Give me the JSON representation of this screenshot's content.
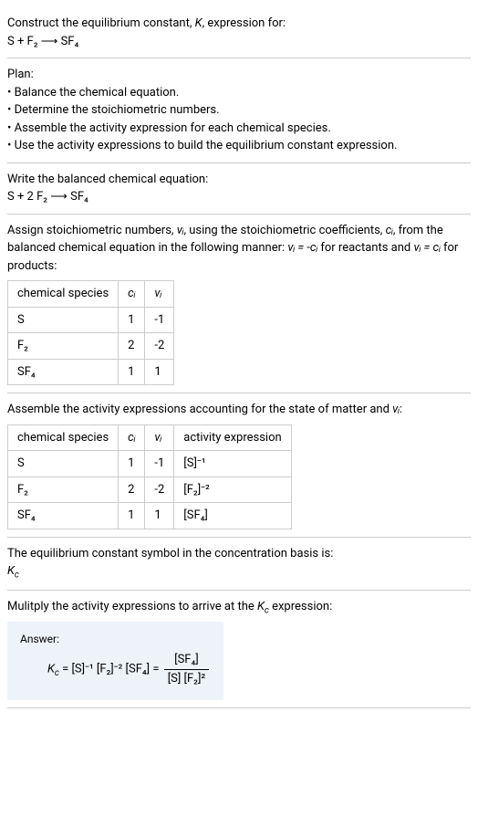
{
  "intro": {
    "line1_a": "Construct the equilibrium constant, ",
    "line1_K": "K",
    "line1_b": ", expression for:",
    "eq": "S + F₂ ⟶ SF₄"
  },
  "plan": {
    "heading": "Plan:",
    "b1": "• Balance the chemical equation.",
    "b2": "• Determine the stoichiometric numbers.",
    "b3": "• Assemble the activity expression for each chemical species.",
    "b4": "• Use the activity expressions to build the equilibrium constant expression."
  },
  "balanced": {
    "line": "Write the balanced chemical equation:",
    "eq": "S + 2 F₂ ⟶ SF₄"
  },
  "stoich": {
    "text_a": "Assign stoichiometric numbers, ",
    "nu_i": "νᵢ",
    "text_b": ", using the stoichiometric coefficients, ",
    "c_i": "cᵢ",
    "text_c": ", from the balanced chemical equation in the following manner: ",
    "rel1": "νᵢ = -cᵢ",
    "text_d": " for reactants and ",
    "rel2": "νᵢ = cᵢ",
    "text_e": " for products:",
    "table": {
      "h1": "chemical species",
      "h2": "cᵢ",
      "h3": "νᵢ",
      "r1": {
        "sp": "S",
        "c": "1",
        "n": "-1"
      },
      "r2": {
        "sp": "F₂",
        "c": "2",
        "n": "-2"
      },
      "r3": {
        "sp": "SF₄",
        "c": "1",
        "n": "1"
      }
    }
  },
  "activity": {
    "text_a": "Assemble the activity expressions accounting for the state of matter and ",
    "nu_i": "νᵢ",
    "text_b": ":",
    "table": {
      "h1": "chemical species",
      "h2": "cᵢ",
      "h3": "νᵢ",
      "h4": "activity expression",
      "r1": {
        "sp": "S",
        "c": "1",
        "n": "-1",
        "a": "[S]⁻¹"
      },
      "r2": {
        "sp": "F₂",
        "c": "2",
        "n": "-2",
        "a": "[F₂]⁻²"
      },
      "r3": {
        "sp": "SF₄",
        "c": "1",
        "n": "1",
        "a": "[SF₄]"
      }
    }
  },
  "symbol": {
    "line": "The equilibrium constant symbol in the concentration basis is:",
    "k": "K",
    "c": "c"
  },
  "multiply": {
    "text_a": "Mulitply the activity expressions to arrive at the ",
    "k": "K",
    "c": "c",
    "text_b": " expression:"
  },
  "answer": {
    "label": "Answer:",
    "k": "K",
    "c": "c",
    "expr_flat": " = [S]⁻¹ [F₂]⁻² [SF₄] = ",
    "num": "[SF₄]",
    "den": "[S] [F₂]²"
  },
  "chart_data": {
    "type": "table",
    "tables": [
      {
        "title": "Stoichiometric coefficients and numbers",
        "columns": [
          "chemical species",
          "c_i",
          "nu_i"
        ],
        "rows": [
          [
            "S",
            1,
            -1
          ],
          [
            "F2",
            2,
            -2
          ],
          [
            "SF4",
            1,
            1
          ]
        ]
      },
      {
        "title": "Activity expressions",
        "columns": [
          "chemical species",
          "c_i",
          "nu_i",
          "activity expression"
        ],
        "rows": [
          [
            "S",
            1,
            -1,
            "[S]^-1"
          ],
          [
            "F2",
            2,
            -2,
            "[F2]^-2"
          ],
          [
            "SF4",
            1,
            1,
            "[SF4]"
          ]
        ]
      }
    ]
  }
}
